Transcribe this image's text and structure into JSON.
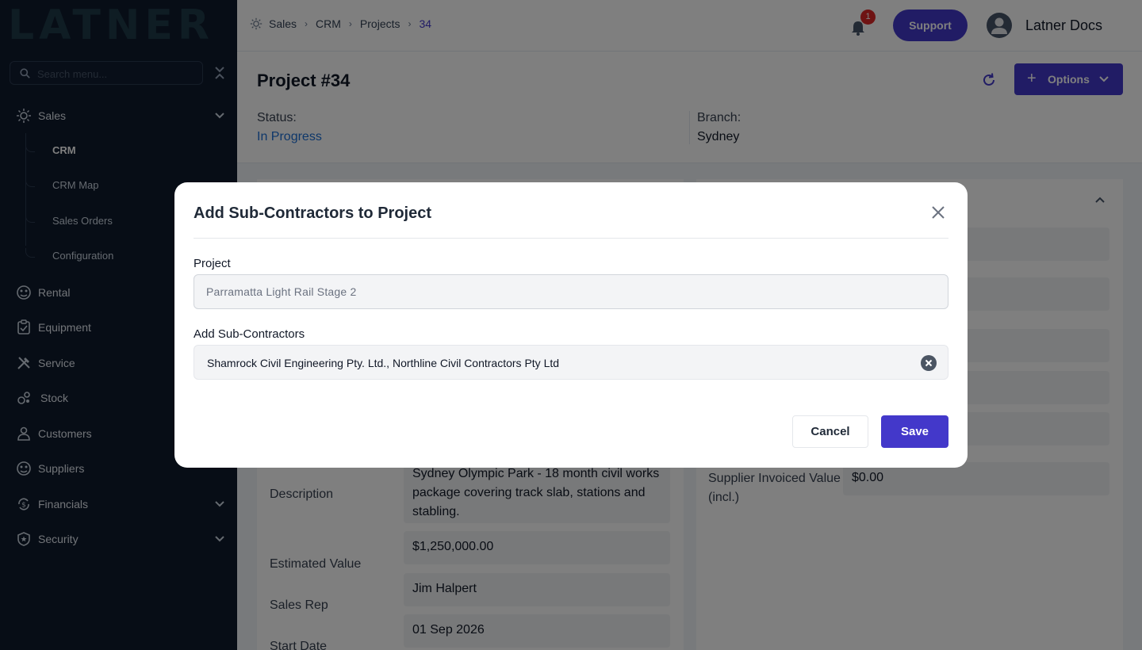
{
  "sidebar": {
    "logo": "LATNER",
    "search_placeholder": "Search menu...",
    "items": [
      {
        "label": "Sales",
        "icon": "sales-icon",
        "expanded": true
      },
      {
        "label": "Rental",
        "icon": "rental-icon"
      },
      {
        "label": "Equipment",
        "icon": "equipment-icon"
      },
      {
        "label": "Service",
        "icon": "service-icon"
      },
      {
        "label": "Stock",
        "icon": "stock-icon"
      },
      {
        "label": "Customers",
        "icon": "customers-icon"
      },
      {
        "label": "Suppliers",
        "icon": "suppliers-icon"
      },
      {
        "label": "Financials",
        "icon": "financials-icon"
      },
      {
        "label": "Security",
        "icon": "security-icon"
      }
    ],
    "sales_sub": [
      "CRM",
      "CRM Map",
      "Sales Orders",
      "Configuration"
    ]
  },
  "topbar": {
    "breadcrumbs": [
      "Sales",
      "CRM",
      "Projects",
      "34"
    ],
    "notification_count": "1",
    "support_label": "Support",
    "user_name": "Latner Docs"
  },
  "project": {
    "title_prefix": "Project",
    "number": "#34",
    "options_label": "Options",
    "status_label": "Status:",
    "status_value": "In Progress",
    "branch_label": "Branch:",
    "branch_value": "Sydney",
    "description_label": "Description",
    "description_value": "Sydney Olympic Park - 18 month civil works package covering track slab, stations and stabling.",
    "estimated_value_label": "Estimated Value",
    "estimated_value": "$1,250,000.00",
    "sales_rep_label": "Sales Rep",
    "sales_rep": "Jim Halpert",
    "start_date_label": "Start Date",
    "start_date": "01 Sep 2026",
    "supplier_invoiced_label": "Supplier Invoiced Value (incl.)",
    "supplier_invoiced_value": "$0.00"
  },
  "modal": {
    "title": "Add Sub-Contractors to Project",
    "project_label": "Project",
    "project_value": "Parramatta Light Rail Stage 2",
    "subcontractors_label": "Add Sub-Contractors",
    "subcontractors_value": "Shamrock Civil Engineering Pty. Ltd., Northline Civil Contractors Pty Ltd",
    "cancel_label": "Cancel",
    "save_label": "Save"
  },
  "colors": {
    "accent": "#4338ca",
    "sidebar_bg": "#0f1a2c",
    "status": "#1d6fd4",
    "badge": "#dc2626"
  }
}
